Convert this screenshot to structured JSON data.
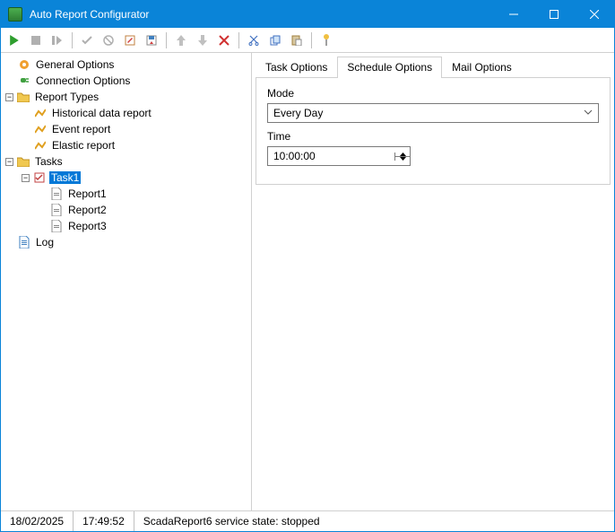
{
  "window": {
    "title": "Auto Report Configurator"
  },
  "toolbar": {
    "items": [
      "run",
      "stop",
      "step",
      "sep",
      "accept",
      "cancel",
      "edit",
      "save",
      "sep",
      "up",
      "down",
      "delete",
      "sep",
      "cut",
      "copy",
      "paste",
      "sep",
      "help"
    ]
  },
  "tree": {
    "general_options": "General Options",
    "connection_options": "Connection Options",
    "report_types": "Report Types",
    "historical_report": "Historical data report",
    "event_report": "Event report",
    "elastic_report": "Elastic report",
    "tasks": "Tasks",
    "task1": "Task1",
    "report1": "Report1",
    "report2": "Report2",
    "report3": "Report3",
    "log": "Log"
  },
  "tabs": {
    "task_options": "Task Options",
    "schedule_options": "Schedule Options",
    "mail_options": "Mail Options"
  },
  "schedule": {
    "mode_label": "Mode",
    "mode_value": "Every Day",
    "time_label": "Time",
    "time_value": "10:00:00"
  },
  "statusbar": {
    "date": "18/02/2025",
    "time": "17:49:52",
    "service": "ScadaReport6 service state: stopped"
  }
}
